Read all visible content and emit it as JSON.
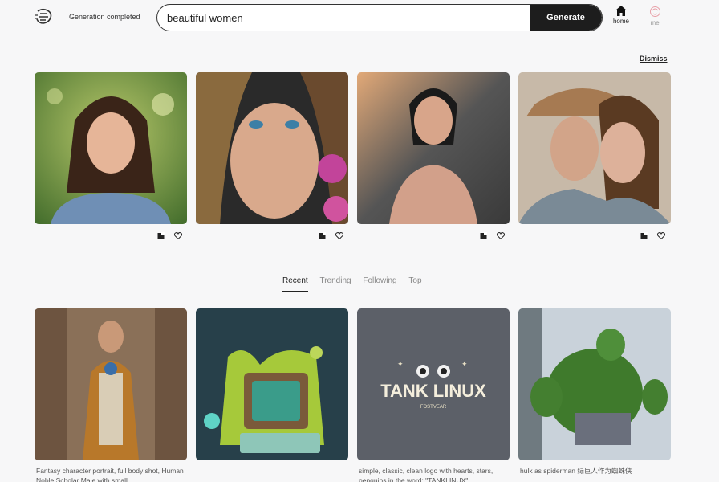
{
  "header": {
    "status": "Generation completed",
    "search_value": "beautiful women",
    "generate_label": "Generate",
    "nav": [
      {
        "label": "home",
        "icon": "home-icon"
      },
      {
        "label": "me",
        "icon": "avatar-icon"
      }
    ]
  },
  "results": {
    "dismiss_label": "Dismiss",
    "images": [
      {
        "name": "woman-denim-portrait"
      },
      {
        "name": "woman-blue-eyes-flowers"
      },
      {
        "name": "woman-studio-portrait"
      },
      {
        "name": "two-women-hat"
      }
    ]
  },
  "tabs": [
    {
      "label": "Recent",
      "active": true
    },
    {
      "label": "Trending",
      "active": false
    },
    {
      "label": "Following",
      "active": false
    },
    {
      "label": "Top",
      "active": false
    }
  ],
  "feed": [
    {
      "caption": "Fantasy character portrait, full body shot, Human Noble Scholar Male with small"
    },
    {
      "caption": ""
    },
    {
      "caption": "simple, classic, clean logo with hearts, stars, penguins in the word: \"TANKLINUX\"",
      "logo_title": "TANK LINUX",
      "logo_sub": "FOSTVEAR"
    },
    {
      "caption": "hulk as spiderman 绿巨人作为蜘蛛侠"
    }
  ],
  "colors": {
    "accent": "#1d1d1d",
    "background": "#f7f7f8"
  }
}
